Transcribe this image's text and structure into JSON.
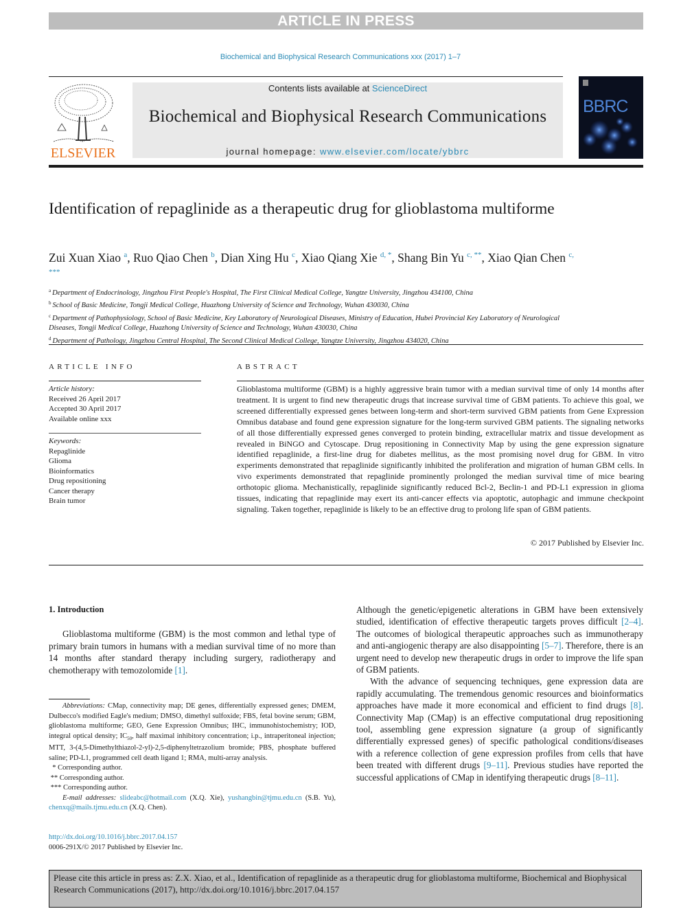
{
  "banner": {
    "label": "ARTICLE IN PRESS"
  },
  "journal_ref": "Biochemical and Biophysical Research Communications xxx (2017) 1–7",
  "header": {
    "publisher_logo_text": "ELSEVIER",
    "contents_prefix": "Contents lists available at ",
    "contents_link": "ScienceDirect",
    "journal_title": "Biochemical and Biophysical Research Communications",
    "homepage_prefix": "journal homepage: ",
    "homepage_link": "www.elsevier.com/locate/ybbrc",
    "cover_title": "BBRC"
  },
  "article": {
    "title": "Identification of repaglinide as a therapeutic drug for glioblastoma multiforme",
    "authors": [
      {
        "name": "Zui Xuan Xiao",
        "sup": "a"
      },
      {
        "name": "Ruo Qiao Chen",
        "sup": "b"
      },
      {
        "name": "Dian Xing Hu",
        "sup": "c"
      },
      {
        "name": "Xiao Qiang Xie",
        "sup": "d, *"
      },
      {
        "name": "Shang Bin Yu",
        "sup": "c, **"
      },
      {
        "name": "Xiao Qian Chen",
        "sup": "c, ***"
      }
    ],
    "affiliations": [
      {
        "sup": "a",
        "text": "Department of Endocrinology, Jingzhou First People's Hospital, The First Clinical Medical College, Yangtze University, Jingzhou 434100, China"
      },
      {
        "sup": "b",
        "text": "School of Basic Medicine, Tongji Medical College, Huazhong University of Science and Technology, Wuhan 430030, China"
      },
      {
        "sup": "c",
        "text": "Department of Pathophysiology, School of Basic Medicine, Key Laboratory of Neurological Diseases, Ministry of Education, Hubei Provincial Key Laboratory of Neurological Diseases, Tongji Medical College, Huazhong University of Science and Technology, Wuhan 430030, China"
      },
      {
        "sup": "d",
        "text": "Department of Pathology, Jingzhou Central Hospital, The Second Clinical Medical College, Yangtze University, Jingzhou 434020, China"
      }
    ]
  },
  "article_info": {
    "heading": "ARTICLE INFO",
    "history_label": "Article history:",
    "history": [
      "Received 26 April 2017",
      "Accepted 30 April 2017",
      "Available online xxx"
    ],
    "keywords_label": "Keywords:",
    "keywords": [
      "Repaglinide",
      "Glioma",
      "Bioinformatics",
      "Drug repositioning",
      "Cancer therapy",
      "Brain tumor"
    ]
  },
  "abstract": {
    "heading": "ABSTRACT",
    "text": "Glioblastoma multiforme (GBM) is a highly aggressive brain tumor with a median survival time of only 14 months after treatment. It is urgent to find new therapeutic drugs that increase survival time of GBM patients. To achieve this goal, we screened differentially expressed genes between long-term and short-term survived GBM patients from Gene Expression Omnibus database and found gene expression signature for the long-term survived GBM patients. The signaling networks of all those differentially expressed genes converged to protein binding, extracellular matrix and tissue development as revealed in BiNGO and Cytoscape. Drug repositioning in Connectivity Map by using the gene expression signature identified repaglinide, a first-line drug for diabetes mellitus, as the most promising novel drug for GBM. In vitro experiments demonstrated that repaglinide significantly inhibited the proliferation and migration of human GBM cells. In vivo experiments demonstrated that repaglinide prominently prolonged the median survival time of mice bearing orthotopic glioma. Mechanistically, repaglinide significantly reduced Bcl-2, Beclin-1 and PD-L1 expression in glioma tissues, indicating that repaglinide may exert its anti-cancer effects via apoptotic, autophagic and immune checkpoint signaling. Taken together, repaglinide is likely to be an effective drug to prolong life span of GBM patients.",
    "copyright": "© 2017 Published by Elsevier Inc."
  },
  "body": {
    "section_heading": "1.  Introduction",
    "left_paragraph": {
      "text": "Glioblastoma multiforme (GBM) is the most common and lethal type of primary brain tumors in humans with a median survival time of no more than 14 months after standard therapy including surgery, radiotherapy and chemotherapy with temozolomide ",
      "ref": "[1]",
      "end": "."
    },
    "right_p1": {
      "t1": "Although the genetic/epigenetic alterations in GBM have been extensively studied, identification of effective therapeutic targets proves difficult ",
      "r1": "[2–4]",
      "t2": ". The outcomes of biological therapeutic approaches such as immunotherapy and anti-angiogenic therapy are also disappointing ",
      "r2": "[5–7]",
      "t3": ". Therefore, there is an urgent need to develop new therapeutic drugs in order to improve the life span of GBM patients."
    },
    "right_p2": {
      "t1": "With the advance of sequencing techniques, gene expression data are rapidly accumulating. The tremendous genomic resources and bioinformatics approaches have made it more economical and efficient to find drugs ",
      "r1": "[8]",
      "t2": ". Connectivity Map (CMap) is an effective computational drug repositioning tool, assembling gene expression signature (a group of significantly differentially expressed genes) of specific pathological conditions/diseases with a reference collection of gene expression profiles from cells that have been treated with different drugs ",
      "r2": "[9–11]",
      "t3": ". Previous studies have reported the successful applications of CMap in identifying therapeutic drugs ",
      "r3": "[8–11]",
      "t4": "."
    }
  },
  "footnotes": {
    "abbrev_label": "Abbreviations:",
    "abbrev_text_1": " CMap, connectivity map; DE genes, differentially expressed genes; DMEM, Dulbecco's modified Eagle's medium; DMSO, dimethyl sulfoxide; FBS, fetal bovine serum; GBM, glioblastoma multiforme; GEO, Gene Expression Omnibus; IHC, immunohistochemistry; IOD, integral optical density; IC",
    "abbrev_sub": "50",
    "abbrev_text_2": ", half maximal inhibitory concentration; i.p., intraperitoneal injection; MTT, 3-(4,5-Dimethylthiazol-2-yl)-2,5-diphenyltetrazolium bromide; PBS, phosphate buffered saline; PD-L1, programmed cell death ligand 1; RMA, multi-array analysis.",
    "corresponding": [
      {
        "mark": "*",
        "text": "Corresponding author."
      },
      {
        "mark": "**",
        "text": "Corresponding author."
      },
      {
        "mark": "***",
        "text": "Corresponding author."
      }
    ],
    "email_label": "E-mail addresses:",
    "emails": [
      {
        "address": "slideabc@hotmail.com",
        "who": " (X.Q. Xie), "
      },
      {
        "address": "yushangbin@tjmu.edu.cn",
        "who": " (S.B. Yu), "
      },
      {
        "address": "chenxq@mails.tjmu.edu.cn",
        "who": " (X.Q. Chen)."
      }
    ],
    "doi_link": "http://dx.doi.org/10.1016/j.bbrc.2017.04.157",
    "issn_line": "0006-291X/© 2017 Published by Elsevier Inc."
  },
  "citation_box": {
    "text": "Please cite this article in press as: Z.X. Xiao, et al., Identification of repaglinide as a therapeutic drug for glioblastoma multiforme, Biochemical and Biophysical Research Communications (2017), http://dx.doi.org/10.1016/j.bbrc.2017.04.157"
  },
  "colors": {
    "link": "#2a8ab5",
    "elsevier_orange": "#e9711c",
    "banner_gray": "#bdbdbd",
    "header_box_gray": "#e9e9e9"
  }
}
